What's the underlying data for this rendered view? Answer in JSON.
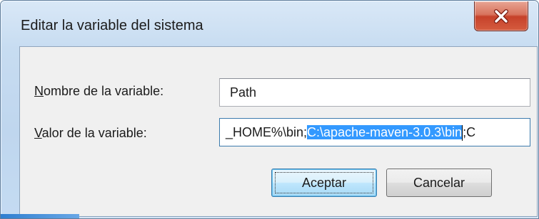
{
  "window": {
    "title": "Editar la variable del sistema"
  },
  "form": {
    "name_label_accel": "N",
    "name_label_rest": "ombre de la variable:",
    "name_value": "Path",
    "value_label_accel": "V",
    "value_label_rest": "alor de la variable:",
    "value_before_selection": "_HOME%\\bin;",
    "value_selected": "C:\\apache-maven-3.0.3\\bin",
    "value_after_selection": ";C"
  },
  "buttons": {
    "ok": "Aceptar",
    "cancel": "Cancelar"
  },
  "icons": {
    "close": "close-icon"
  },
  "colors": {
    "selection": "#3399ff",
    "close_button": "#c6412a",
    "dialog_bg": "#f0f0f0"
  }
}
